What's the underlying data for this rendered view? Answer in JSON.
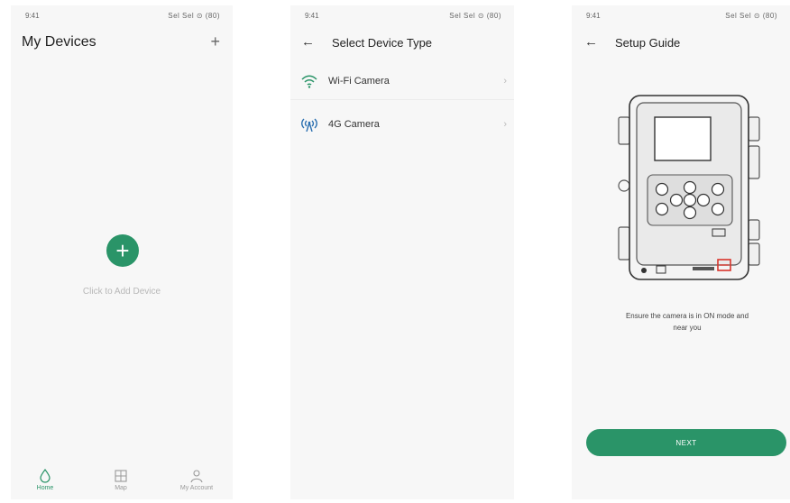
{
  "status": {
    "time": "9:41",
    "signal": "Sel Sel ⊙ (80)"
  },
  "screen1": {
    "title": "My Devices",
    "add_icon_label": "+",
    "add_circle_label": "+",
    "add_text": "Click to Add Device",
    "tabs": [
      {
        "label": "Home",
        "icon": "home-icon",
        "active": true
      },
      {
        "label": "Map",
        "icon": "map-icon",
        "active": false
      },
      {
        "label": "My Account",
        "icon": "person-icon",
        "active": false
      }
    ]
  },
  "screen2": {
    "back": "←",
    "title": "Select Device Type",
    "items": [
      {
        "label": "Wi-Fi Camera",
        "icon": "wifi-icon",
        "chevron": "›"
      },
      {
        "label": "4G Camera",
        "icon": "antenna-icon",
        "chevron": "›"
      }
    ]
  },
  "screen3": {
    "back": "←",
    "title": "Setup Guide",
    "image": "trail-camera-illustration",
    "hint_line1": "Ensure the camera is in ON mode and",
    "hint_line2": "near you",
    "button": "NEXT"
  },
  "colors": {
    "accent": "#2a9468",
    "background": "#f7f7f7",
    "muted": "#b8b8b8"
  }
}
